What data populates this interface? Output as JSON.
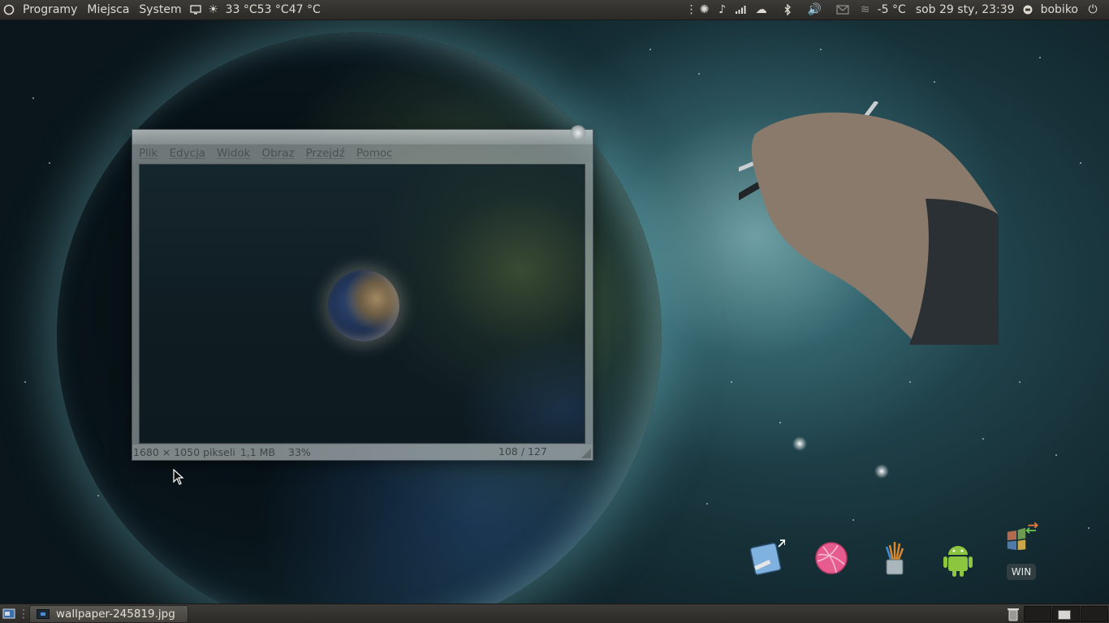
{
  "top_panel": {
    "menus": [
      "Programy",
      "Miejsca",
      "System"
    ],
    "weather_readings": [
      "33 °C",
      "53 °C",
      "47 °C"
    ],
    "temperature": "-5 °C",
    "clock": "sob 29 sty, 23:39",
    "user": "bobiko",
    "icons": [
      "ubuntu-logo-icon",
      "display-icon",
      "sun-icon",
      "separator-handle",
      "shutter-icon",
      "music-icon",
      "network-signal-icon",
      "cloud-icon",
      "bluetooth-icon",
      "volume-icon",
      "mail-icon",
      "fog-icon",
      "user-chat-icon",
      "power-icon"
    ]
  },
  "viewer": {
    "menu": [
      "Plik",
      "Edycja",
      "Widok",
      "Obraz",
      "Przejdź",
      "Pomoc"
    ],
    "status": {
      "dimensions": "1680 × 1050 pikseli",
      "size": "1,1 MB",
      "zoom": "33%",
      "index": "108 / 127"
    }
  },
  "dock": {
    "items": [
      "draw-app-icon",
      "dribbble-icon",
      "pencil-cup-icon",
      "android-icon",
      "windows-icon"
    ],
    "win_label": "WIN"
  },
  "bottom_panel": {
    "task": "wallpaper-245819.jpg",
    "workspaces": 3,
    "active_workspace": 2
  },
  "colors": {
    "panel": "#3c3b37",
    "panel_text": "#dfdbd2",
    "accent_blue": "#4d8bd1"
  }
}
